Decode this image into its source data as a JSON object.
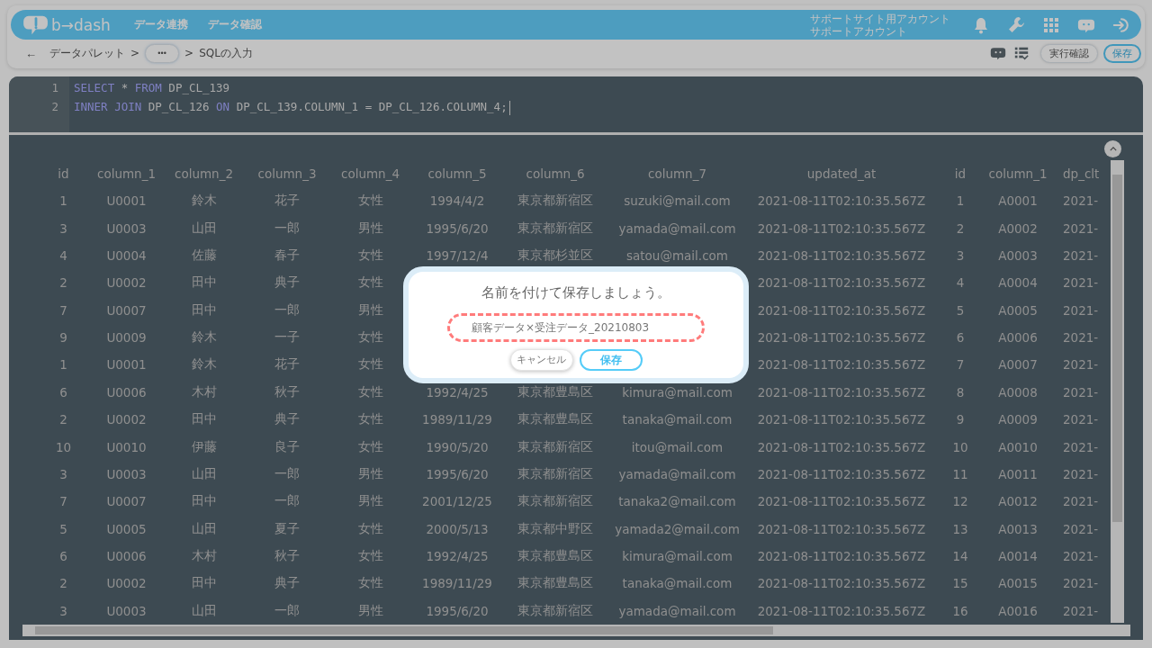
{
  "header": {
    "logo": "b→dash",
    "nav": [
      {
        "label": "データ連携"
      },
      {
        "label": "データ確認"
      }
    ],
    "account": [
      "サポートサイト用アカウント",
      "サポートアカウント"
    ]
  },
  "breadcrumb": {
    "back": "←",
    "items": [
      {
        "kind": "text",
        "label": "データパレット"
      },
      {
        "kind": "sep",
        "label": ">"
      },
      {
        "kind": "more",
        "label": "•••"
      },
      {
        "kind": "sep",
        "label": ">"
      },
      {
        "kind": "text",
        "label": "SQLの入力"
      }
    ]
  },
  "toolbar": {
    "buttons": [
      {
        "kind": "secondary",
        "label": "実行確認"
      },
      {
        "kind": "primary",
        "label": "保存"
      }
    ]
  },
  "editor": {
    "lines": [
      {
        "number": "1",
        "tokens": [
          {
            "kind": "keyword",
            "text": "SELECT"
          },
          {
            "kind": "text",
            "text": " * "
          },
          {
            "kind": "keyword",
            "text": "FROM"
          },
          {
            "kind": "text",
            "text": " DP_CL_139"
          }
        ]
      },
      {
        "number": "2",
        "tokens": [
          {
            "kind": "keyword",
            "text": "INNER JOIN"
          },
          {
            "kind": "text",
            "text": " DP_CL_126 "
          },
          {
            "kind": "keyword",
            "text": "ON"
          },
          {
            "kind": "text",
            "text": " DP_CL_139.COLUMN_1 = DP_CL_126.COLUMN_4;"
          }
        ]
      }
    ]
  },
  "table": {
    "columns": [
      "id",
      "column_1",
      "column_2",
      "column_3",
      "column_4",
      "column_5",
      "column_6",
      "column_7",
      "updated_at",
      "id",
      "column_1",
      "dp_clt"
    ],
    "rows": [
      [
        "1",
        "U0001",
        "鈴木",
        "花子",
        "女性",
        "1994/4/2",
        "東京都新宿区",
        "suzuki@mail.com",
        "2021-08-11T02:10:35.567Z",
        "1",
        "A0001",
        "2021-"
      ],
      [
        "3",
        "U0003",
        "山田",
        "一郎",
        "男性",
        "1995/6/20",
        "東京都新宿区",
        "yamada@mail.com",
        "2021-08-11T02:10:35.567Z",
        "2",
        "A0002",
        "2021-"
      ],
      [
        "4",
        "U0004",
        "佐藤",
        "春子",
        "女性",
        "1997/12/4",
        "東京都杉並区",
        "satou@mail.com",
        "2021-08-11T02:10:35.567Z",
        "3",
        "A0003",
        "2021-"
      ],
      [
        "2",
        "U0002",
        "田中",
        "典子",
        "女性",
        null,
        null,
        null,
        "2021-08-11T02:10:35.567Z",
        "4",
        "A0004",
        "2021-"
      ],
      [
        "7",
        "U0007",
        "田中",
        "一郎",
        "男性",
        null,
        null,
        null,
        "2021-08-11T02:10:35.567Z",
        "5",
        "A0005",
        "2021-"
      ],
      [
        "9",
        "U0009",
        "鈴木",
        "一子",
        "女性",
        null,
        null,
        null,
        "2021-08-11T02:10:35.567Z",
        "6",
        "A0006",
        "2021-"
      ],
      [
        "1",
        "U0001",
        "鈴木",
        "花子",
        "女性",
        null,
        null,
        null,
        "2021-08-11T02:10:35.567Z",
        "7",
        "A0007",
        "2021-"
      ],
      [
        "6",
        "U0006",
        "木村",
        "秋子",
        "女性",
        "1992/4/25",
        "東京都豊島区",
        "kimura@mail.com",
        "2021-08-11T02:10:35.567Z",
        "8",
        "A0008",
        "2021-"
      ],
      [
        "2",
        "U0002",
        "田中",
        "典子",
        "女性",
        "1989/11/29",
        "東京都豊島区",
        "tanaka@mail.com",
        "2021-08-11T02:10:35.567Z",
        "9",
        "A0009",
        "2021-"
      ],
      [
        "10",
        "U0010",
        "伊藤",
        "良子",
        "女性",
        "1990/5/20",
        "東京都新宿区",
        "itou@mail.com",
        "2021-08-11T02:10:35.567Z",
        "10",
        "A0010",
        "2021-"
      ],
      [
        "3",
        "U0003",
        "山田",
        "一郎",
        "男性",
        "1995/6/20",
        "東京都新宿区",
        "yamada@mail.com",
        "2021-08-11T02:10:35.567Z",
        "11",
        "A0011",
        "2021-"
      ],
      [
        "7",
        "U0007",
        "田中",
        "一郎",
        "男性",
        "2001/12/25",
        "東京都新宿区",
        "tanaka2@mail.com",
        "2021-08-11T02:10:35.567Z",
        "12",
        "A0012",
        "2021-"
      ],
      [
        "5",
        "U0005",
        "山田",
        "夏子",
        "女性",
        "2000/5/13",
        "東京都中野区",
        "yamada2@mail.com",
        "2021-08-11T02:10:35.567Z",
        "13",
        "A0013",
        "2021-"
      ],
      [
        "6",
        "U0006",
        "木村",
        "秋子",
        "女性",
        "1992/4/25",
        "東京都豊島区",
        "kimura@mail.com",
        "2021-08-11T02:10:35.567Z",
        "14",
        "A0014",
        "2021-"
      ],
      [
        "2",
        "U0002",
        "田中",
        "典子",
        "女性",
        "1989/11/29",
        "東京都豊島区",
        "tanaka@mail.com",
        "2021-08-11T02:10:35.567Z",
        "15",
        "A0015",
        "2021-"
      ],
      [
        "3",
        "U0003",
        "山田",
        "一郎",
        "男性",
        "1995/6/20",
        "東京都新宿区",
        "yamada@mail.com",
        "2021-08-11T02:10:35.567Z",
        "16",
        "A0016",
        "2021-"
      ]
    ]
  },
  "dialog": {
    "title": "名前を付けて保存しましょう。",
    "value": "顧客データ×受注データ_20210803",
    "buttons": [
      {
        "kind": "secondary",
        "label": "キャンセル"
      },
      {
        "kind": "primary",
        "label": "保存"
      }
    ]
  }
}
